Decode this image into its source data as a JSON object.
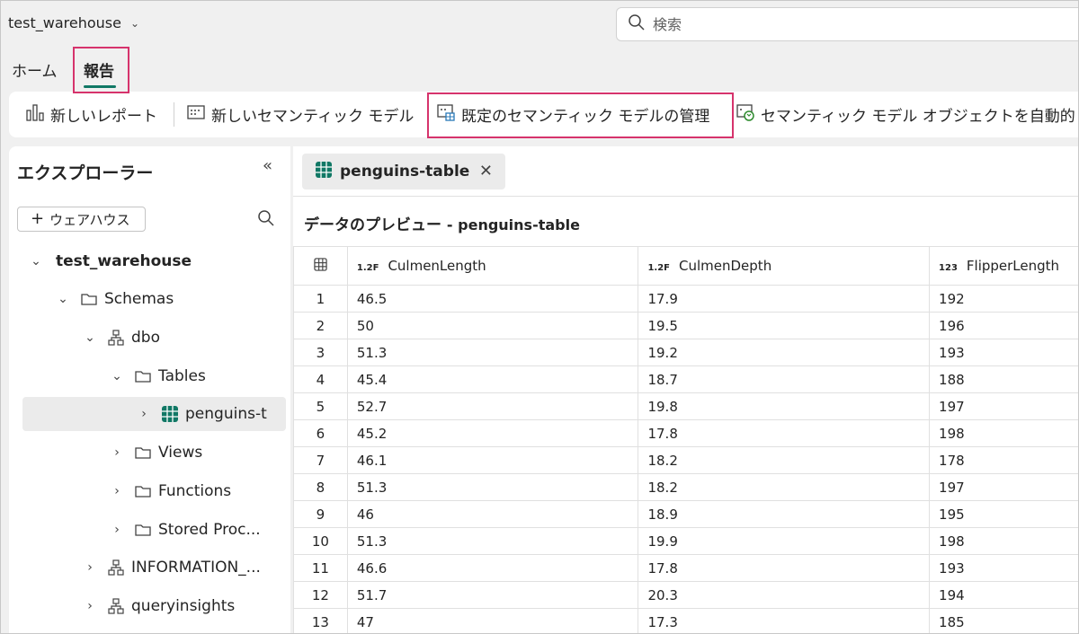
{
  "header": {
    "workspace": "test_warehouse",
    "search_placeholder": "検索"
  },
  "tabs": {
    "home": "ホーム",
    "report": "報告"
  },
  "toolbar": {
    "new_report": "新しいレポート",
    "new_semantic_model": "新しいセマンティック モデル",
    "manage_default_model": "既定のセマンティック モデルの管理",
    "auto_update": "セマンティック モデル オブジェクトを自動的"
  },
  "explorer": {
    "title": "エクスプローラー",
    "add_warehouse": "ウェアハウス",
    "tree": [
      {
        "label": "test_warehouse",
        "icon": "none",
        "caret": "down"
      },
      {
        "label": "Schemas",
        "icon": "folder",
        "caret": "down"
      },
      {
        "label": "dbo",
        "icon": "schema",
        "caret": "down"
      },
      {
        "label": "Tables",
        "icon": "folder",
        "caret": "down"
      },
      {
        "label": "penguins-t",
        "icon": "table",
        "caret": "right"
      },
      {
        "label": "Views",
        "icon": "folder",
        "caret": "right"
      },
      {
        "label": "Functions",
        "icon": "folder",
        "caret": "right"
      },
      {
        "label": "Stored Proc...",
        "icon": "folder",
        "caret": "right"
      },
      {
        "label": "INFORMATION_...",
        "icon": "schema",
        "caret": "right"
      },
      {
        "label": "queryinsights",
        "icon": "schema",
        "caret": "right"
      }
    ]
  },
  "main": {
    "doc_tab": "penguins-table",
    "preview_title": "データのプレビュー",
    "preview_subtitle": "- penguins-table",
    "columns": [
      {
        "type": "1.2F",
        "name": "CulmenLength"
      },
      {
        "type": "1.2F",
        "name": "CulmenDepth"
      },
      {
        "type": "123",
        "name": "FlipperLength"
      }
    ],
    "rows": [
      [
        "1",
        "46.5",
        "17.9",
        "192"
      ],
      [
        "2",
        "50",
        "19.5",
        "196"
      ],
      [
        "3",
        "51.3",
        "19.2",
        "193"
      ],
      [
        "4",
        "45.4",
        "18.7",
        "188"
      ],
      [
        "5",
        "52.7",
        "19.8",
        "197"
      ],
      [
        "6",
        "45.2",
        "17.8",
        "198"
      ],
      [
        "7",
        "46.1",
        "18.2",
        "178"
      ],
      [
        "8",
        "51.3",
        "18.2",
        "197"
      ],
      [
        "9",
        "46",
        "18.9",
        "195"
      ],
      [
        "10",
        "51.3",
        "19.9",
        "198"
      ],
      [
        "11",
        "46.6",
        "17.8",
        "193"
      ],
      [
        "12",
        "51.7",
        "20.3",
        "194"
      ],
      [
        "13",
        "47",
        "17.3",
        "185"
      ]
    ]
  },
  "colors": {
    "accent": "#117865",
    "highlight": "#d6336c",
    "table_icon": "#117865"
  }
}
